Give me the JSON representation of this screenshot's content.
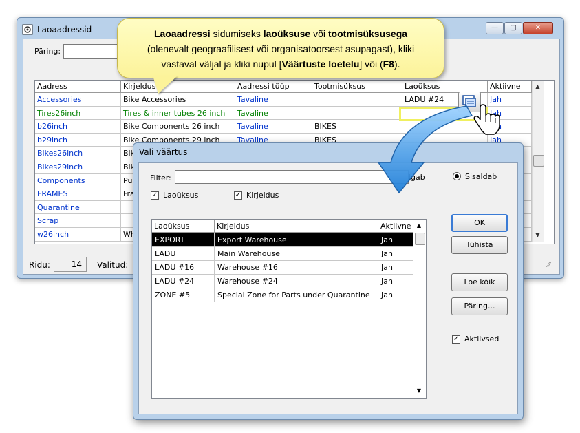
{
  "main_window": {
    "title": "Laoaadressid",
    "query_label": "Päring:",
    "rows_label": "Ridu:",
    "rows_value": "14",
    "selected_label": "Valitud:",
    "controls": {
      "minimize": "—",
      "maximize": "▢",
      "close": "✕"
    }
  },
  "grid": {
    "columns": [
      "Aadress",
      "Kirjeldus",
      "Aadressi tüüp",
      "Tootmisüksus",
      "Laoüksus",
      "Aktiivne"
    ],
    "rows": [
      {
        "address": "Accessories",
        "description": "Bike Accessories",
        "type": "Tavaline",
        "production": "",
        "location": "LADU #24",
        "active": "Jah"
      },
      {
        "address": "Tires26inch",
        "description": "Tires & inner tubes 26 inch",
        "type": "Tavaline",
        "production": "",
        "location": "",
        "active": "Jah"
      },
      {
        "address": "b26inch",
        "description": "Bike Components 26 inch",
        "type": "Tavaline",
        "production": "BIKES",
        "location": "",
        "active": "Jah"
      },
      {
        "address": "b29inch",
        "description": "Bike Components 29 inch",
        "type": "Tavaline",
        "production": "BIKES",
        "location": "",
        "active": "Jah"
      },
      {
        "address": "Bikes26inch",
        "description": "Bik",
        "type": "",
        "production": "",
        "location": "",
        "active": ""
      },
      {
        "address": "Bikes29inch",
        "description": "Bik",
        "type": "",
        "production": "",
        "location": "",
        "active": ""
      },
      {
        "address": "Components",
        "description": "Pu",
        "type": "",
        "production": "",
        "location": "",
        "active": ""
      },
      {
        "address": "FRAMES",
        "description": "Fra",
        "type": "",
        "production": "",
        "location": "",
        "active": ""
      },
      {
        "address": "Quarantine",
        "description": "",
        "type": "",
        "production": "",
        "location": "",
        "active": ""
      },
      {
        "address": "Scrap",
        "description": "",
        "type": "",
        "production": "",
        "location": "",
        "active": ""
      },
      {
        "address": "w26inch",
        "description": "Wh",
        "type": "",
        "production": "",
        "location": "",
        "active": ""
      }
    ]
  },
  "callout": {
    "line1_bold1": "Laoaadressi",
    "line1_mid1": " sidumiseks ",
    "line1_bold2": "laoüksuse",
    "line1_mid2": " või ",
    "line1_bold3": "tootmisüksusega",
    "line2": "(olenevalt geograafilisest või organisatoorsest asupagast), kliki",
    "line3_pre": "vastaval väljal ja kliki nupul [",
    "line3_bold1": "Väärtuste loetelu",
    "line3_mid": "] või (",
    "line3_bold2": "F8",
    "line3_post": ")."
  },
  "dialog": {
    "title": "Vali väärtus",
    "filter_label": "Filter:",
    "starts_with_label": "lgab",
    "contains_label": "Sisaldab",
    "checkbox_location": "Laoüksus",
    "checkbox_description": "Kirjeldus",
    "checkbox_active": "Aktiivsed",
    "buttons": {
      "ok": "OK",
      "cancel": "Tühista",
      "load_all": "Loe kõik",
      "query": "Päring..."
    },
    "columns": [
      "Laoüksus",
      "Kirjeldus",
      "Aktiivne"
    ],
    "rows": [
      {
        "code": "EXPORT",
        "description": "Export Warehouse",
        "active": "Jah"
      },
      {
        "code": "LADU",
        "description": "Main Warehouse",
        "active": "Jah"
      },
      {
        "code": "LADU #16",
        "description": "Warehouse #16",
        "active": "Jah"
      },
      {
        "code": "LADU #24",
        "description": "Warehouse #24",
        "active": "Jah"
      },
      {
        "code": "ZONE #5",
        "description": "Special Zone for Parts under Quarantine",
        "active": "Jah"
      }
    ]
  }
}
